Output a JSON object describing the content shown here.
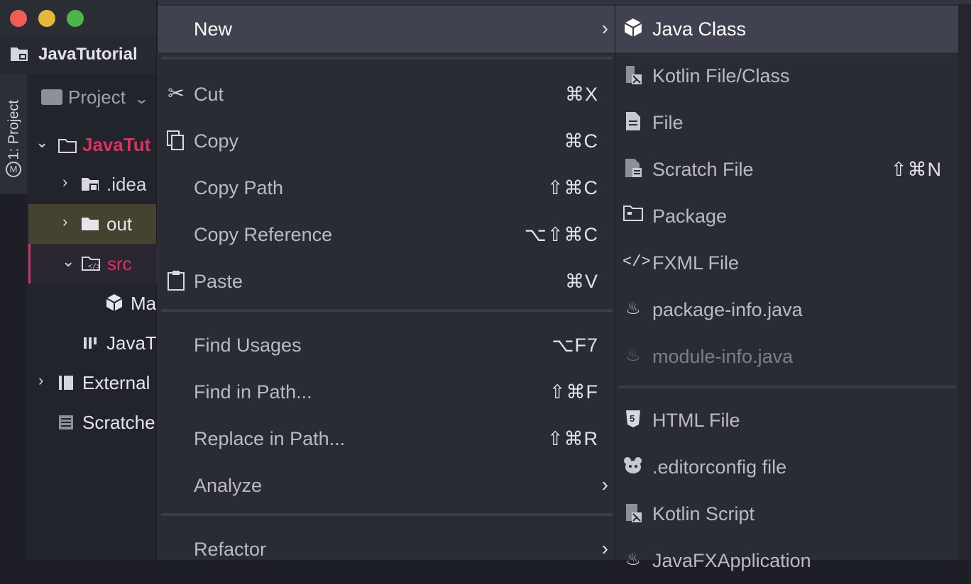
{
  "window": {
    "project_name": "JavaTutorial"
  },
  "tool_window": {
    "side_tab_label": "1: Project",
    "view_selector": "Project"
  },
  "tree": {
    "root": "JavaTut",
    "idea": ".idea",
    "out": "out",
    "src": "src",
    "main_file": "Ma",
    "iml_file": "JavaT",
    "external": "External",
    "scratches": "Scratche"
  },
  "context_menu": {
    "new": {
      "label": "New"
    },
    "cut": {
      "label": "Cut",
      "shortcut": "⌘X"
    },
    "copy": {
      "label": "Copy",
      "shortcut": "⌘C"
    },
    "copy_path": {
      "label": "Copy Path",
      "shortcut": "⇧⌘C"
    },
    "copy_reference": {
      "label": "Copy Reference",
      "shortcut": "⌥⇧⌘C"
    },
    "paste": {
      "label": "Paste",
      "shortcut": "⌘V"
    },
    "find_usages": {
      "label": "Find Usages",
      "shortcut": "⌥F7"
    },
    "find_in_path": {
      "label": "Find in Path...",
      "shortcut": "⇧⌘F"
    },
    "replace_in_path": {
      "label": "Replace in Path...",
      "shortcut": "⇧⌘R"
    },
    "analyze": {
      "label": "Analyze"
    },
    "refactor": {
      "label": "Refactor"
    }
  },
  "new_submenu": {
    "java_class": "Java Class",
    "kotlin_file": "Kotlin File/Class",
    "file": "File",
    "scratch_file": {
      "label": "Scratch File",
      "shortcut": "⇧⌘N"
    },
    "package": "Package",
    "fxml_file": "FXML File",
    "package_info": "package-info.java",
    "module_info": "module-info.java",
    "html_file": "HTML File",
    "editorconfig": ".editorconfig file",
    "kotlin_script": "Kotlin Script",
    "javafx_app": "JavaFXApplication"
  },
  "colors": {
    "accent_red": "#e0305f",
    "selection": "#40424f",
    "menu_bg": "#2a2c35"
  }
}
